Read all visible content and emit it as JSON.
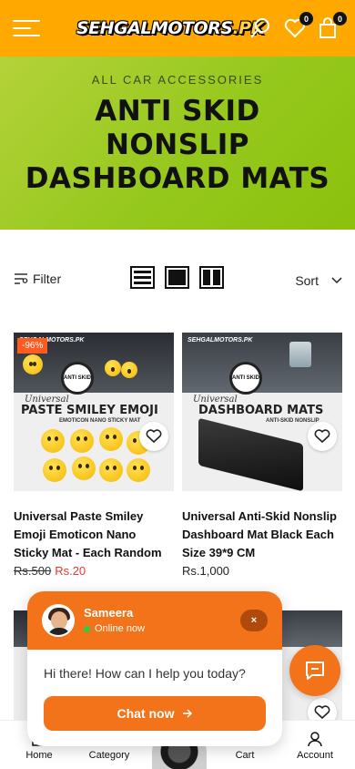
{
  "header": {
    "logo_main": "SEHGALMOTORS",
    "logo_suffix": ".PK",
    "wishlist_count": "0",
    "cart_count": "0",
    "bg_color": "#ffa800"
  },
  "hero": {
    "subtitle": "ALL CAR ACCESSORIES",
    "title_line1": "ANTI SKID",
    "title_line2": "NONSLIP",
    "title_line3": "DASHBOARD MATS"
  },
  "toolbar": {
    "filter_label": "Filter",
    "sort_label": "Sort"
  },
  "products": [
    {
      "img_brand": "SEHGALMOTORS.PK",
      "img_badge": "ANTI SKID",
      "img_universal": "Universal",
      "img_title": "PASTE SMILEY EMOJI",
      "img_caption": "EMOTICON NANO STICKY MAT",
      "discount": "-96%",
      "name": "Universal Paste Smiley Emoji Emoticon Nano Sticky Mat - Each Random",
      "price_old": "Rs.500",
      "price_new": "Rs.20"
    },
    {
      "img_brand": "SEHGALMOTORS.PK",
      "img_badge": "ANTI SKID",
      "img_universal": "Universal",
      "img_title": "DASHBOARD MATS",
      "img_caption": "ANTI-SKID NONSLIP",
      "name": "Universal Anti-Skid Nonslip Dashboard Mat Black Each Size 39*9 CM",
      "price": "Rs.1,000"
    }
  ],
  "chat": {
    "agent_name": "Sameera",
    "status": "Online now",
    "message": "Hi there! How can I help you today?",
    "button_label": "Chat now",
    "close_label": "×",
    "accent": "#f27319"
  },
  "bottom_nav": {
    "home": "Home",
    "category": "Category",
    "cart": "Cart",
    "account": "Account"
  }
}
